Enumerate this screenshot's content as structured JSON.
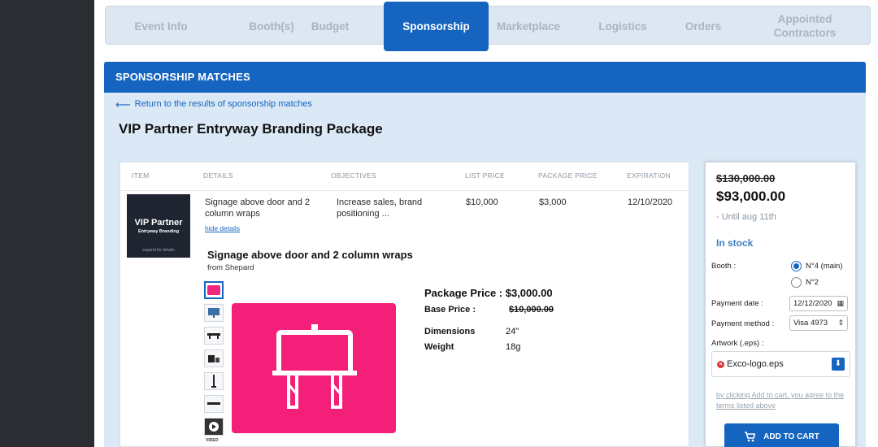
{
  "tabs": [
    {
      "label": "Event Info"
    },
    {
      "label": "Booth(s)"
    },
    {
      "label": "Budget"
    },
    {
      "label": "Sponsorship"
    },
    {
      "label": "Marketplace"
    },
    {
      "label": "Logistics"
    },
    {
      "label": "Orders"
    },
    {
      "label": "Appointed Contractors"
    }
  ],
  "active_tab": "Sponsorship",
  "section": {
    "title": "SPONSORSHIP MATCHES"
  },
  "back_link": "Return to the results of sponsorship matches",
  "page_title": "VIP Partner Entryway Branding Package",
  "table": {
    "headers": [
      "ITEM",
      "DETAILS",
      "OBJECTIVES",
      "LIST PRICE",
      "PACKAGE PRICE",
      "EXPIRATION"
    ],
    "row": {
      "thumb_title": "VIP Partner",
      "thumb_subtitle": "Entryway Branding",
      "thumb_caption": "expand for details",
      "details": "Signage above door and 2 column wraps",
      "hide_details": "hide details",
      "objectives": "Increase sales, brand positioning ...",
      "list_price": "$10,000",
      "package_price": "$3,000",
      "expiration": "12/10/2020"
    }
  },
  "detail": {
    "title": "Signage above door and 2 column wraps",
    "from": "from Shepard",
    "package_price": "Package Price : $3,000.00",
    "base_price_label": "Base Price :",
    "base_price_value": "$10,000.00",
    "dimensions_label": "Dimensions",
    "dimensions_value": "24\"",
    "weight_label": "Weight",
    "weight_value": "18g",
    "video_label": "VIDEO",
    "thumbnails": [
      "cart-icon",
      "monitor-icon",
      "bench-icon",
      "equipment-icon",
      "stand-icon",
      "table-icon",
      "video-icon"
    ]
  },
  "summary": {
    "old_price": "$130,000.00",
    "new_price": "$93,000.00",
    "until": "- Until aug 11th",
    "stock": "In stock",
    "booth_label": "Booth :",
    "booth_options": [
      "N°4 (main)",
      "N°2"
    ],
    "booth_selected": "N°4 (main)",
    "payment_date_label": "Payment date :",
    "payment_date": "12/12/2020",
    "payment_method_label": "Payment method :",
    "payment_method": "Visa 4973",
    "artwork_label": "Artwork (.eps) :",
    "artwork_file": "Exco-logo.eps",
    "terms": "by clicking Add to cart, you agree to the terms listed above",
    "cart_button": "ADD TO CART"
  },
  "colors": {
    "primary": "#1565c0",
    "panel_bg": "#dbe9f6",
    "accent_pink": "#f41f79",
    "sidebar": "#2b2d33"
  }
}
